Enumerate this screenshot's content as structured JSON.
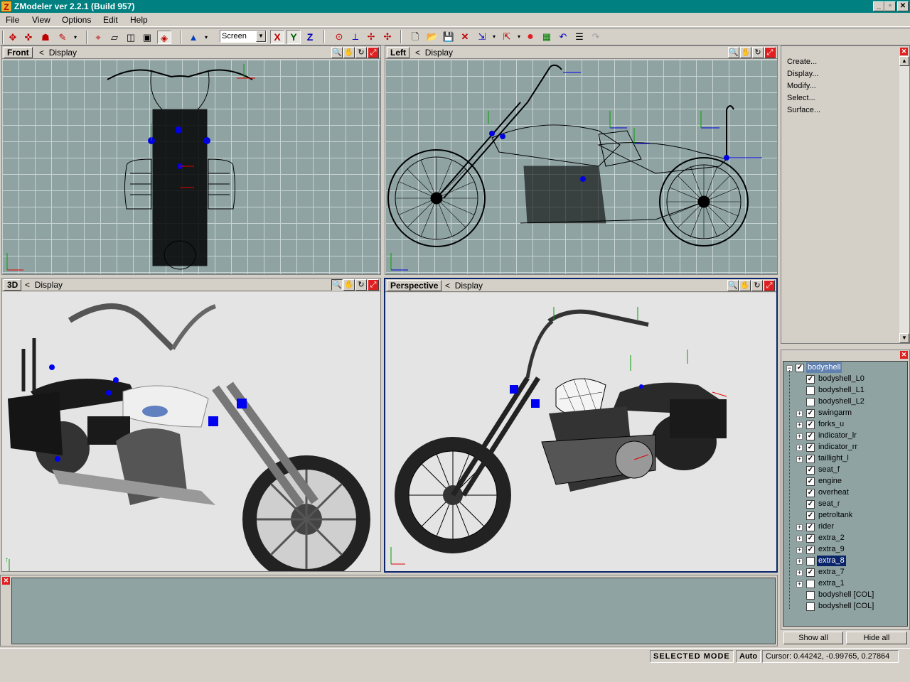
{
  "app": {
    "title": "ZModeler ver 2.2.1 (Build 957)",
    "icon_letter": "Z",
    "window_buttons": [
      "_",
      "▫",
      "✕"
    ]
  },
  "menu": [
    "File",
    "View",
    "Options",
    "Edit",
    "Help"
  ],
  "toolbar": {
    "coord_space": "Screen",
    "axes": [
      "X",
      "Y",
      "Z"
    ]
  },
  "viewports": [
    {
      "name": "Front",
      "display": "Display",
      "mode": "wireframe-front"
    },
    {
      "name": "Left",
      "display": "Display",
      "mode": "wireframe-side"
    },
    {
      "name": "3D",
      "display": "Display",
      "mode": "textured"
    },
    {
      "name": "Perspective",
      "display": "Display",
      "mode": "wireframe-perspective"
    }
  ],
  "command_panel": {
    "items": [
      "Create...",
      "Display...",
      "Modify...",
      "Select...",
      "Surface..."
    ]
  },
  "hierarchy": {
    "root": {
      "label": "bodyshell",
      "checked": true
    },
    "items": [
      {
        "label": "bodyshell_L0",
        "checked": true,
        "expandable": false
      },
      {
        "label": "bodyshell_L1",
        "checked": false,
        "expandable": false
      },
      {
        "label": "bodyshell_L2",
        "checked": false,
        "expandable": false
      },
      {
        "label": "swingarm",
        "checked": true,
        "expandable": true
      },
      {
        "label": "forks_u",
        "checked": true,
        "expandable": true
      },
      {
        "label": "indicator_lr",
        "checked": true,
        "expandable": true
      },
      {
        "label": "indicator_rr",
        "checked": true,
        "expandable": true
      },
      {
        "label": "taillight_l",
        "checked": true,
        "expandable": true
      },
      {
        "label": "seat_f",
        "checked": true,
        "expandable": false
      },
      {
        "label": "engine",
        "checked": true,
        "expandable": false
      },
      {
        "label": "overheat",
        "checked": true,
        "expandable": false
      },
      {
        "label": "seat_r",
        "checked": true,
        "expandable": false
      },
      {
        "label": "petroltank",
        "checked": true,
        "expandable": false
      },
      {
        "label": "rider",
        "checked": true,
        "expandable": true
      },
      {
        "label": "extra_2",
        "checked": true,
        "expandable": true
      },
      {
        "label": "extra_9",
        "checked": true,
        "expandable": true
      },
      {
        "label": "extra_8",
        "checked": false,
        "expandable": true,
        "selected": true
      },
      {
        "label": "extra_7",
        "checked": true,
        "expandable": true
      },
      {
        "label": "extra_1",
        "checked": false,
        "expandable": true
      },
      {
        "label": "bodyshell [COL]",
        "checked": false,
        "expandable": false
      },
      {
        "label": "bodyshell [COL]",
        "checked": false,
        "expandable": false
      }
    ],
    "show_all": "Show all",
    "hide_all": "Hide all"
  },
  "status": {
    "mode": "SELECTED MODE",
    "auto": "Auto",
    "cursor": "Cursor: 0.44242, -0.99765, 0.27864"
  },
  "colors": {
    "titlebar": "#008080",
    "selection": "#0a246a",
    "viewport_bg": "#8fa3a3",
    "close_red": "#e02020"
  }
}
